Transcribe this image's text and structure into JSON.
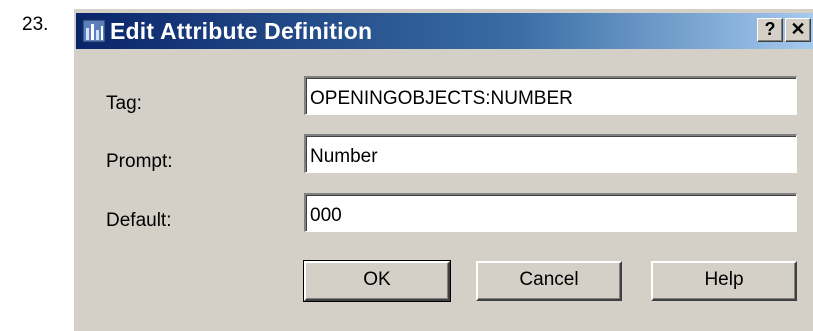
{
  "step": {
    "number": "23."
  },
  "window": {
    "title": "Edit Attribute Definition",
    "help_button": "?",
    "close_button": "✕"
  },
  "form": {
    "tag": {
      "label": "Tag:",
      "value": "OPENINGOBJECTS:NUMBER"
    },
    "prompt": {
      "label": "Prompt:",
      "value": "Number"
    },
    "default": {
      "label": "Default:",
      "value": "000"
    }
  },
  "buttons": {
    "ok": "OK",
    "cancel": "Cancel",
    "help": "Help"
  },
  "colors": {
    "dialog_bg": "#d4d0c8",
    "titlebar_start": "#0a246a",
    "titlebar_end": "#a6caf0"
  },
  "icons": {
    "app": "acad-app-icon"
  }
}
